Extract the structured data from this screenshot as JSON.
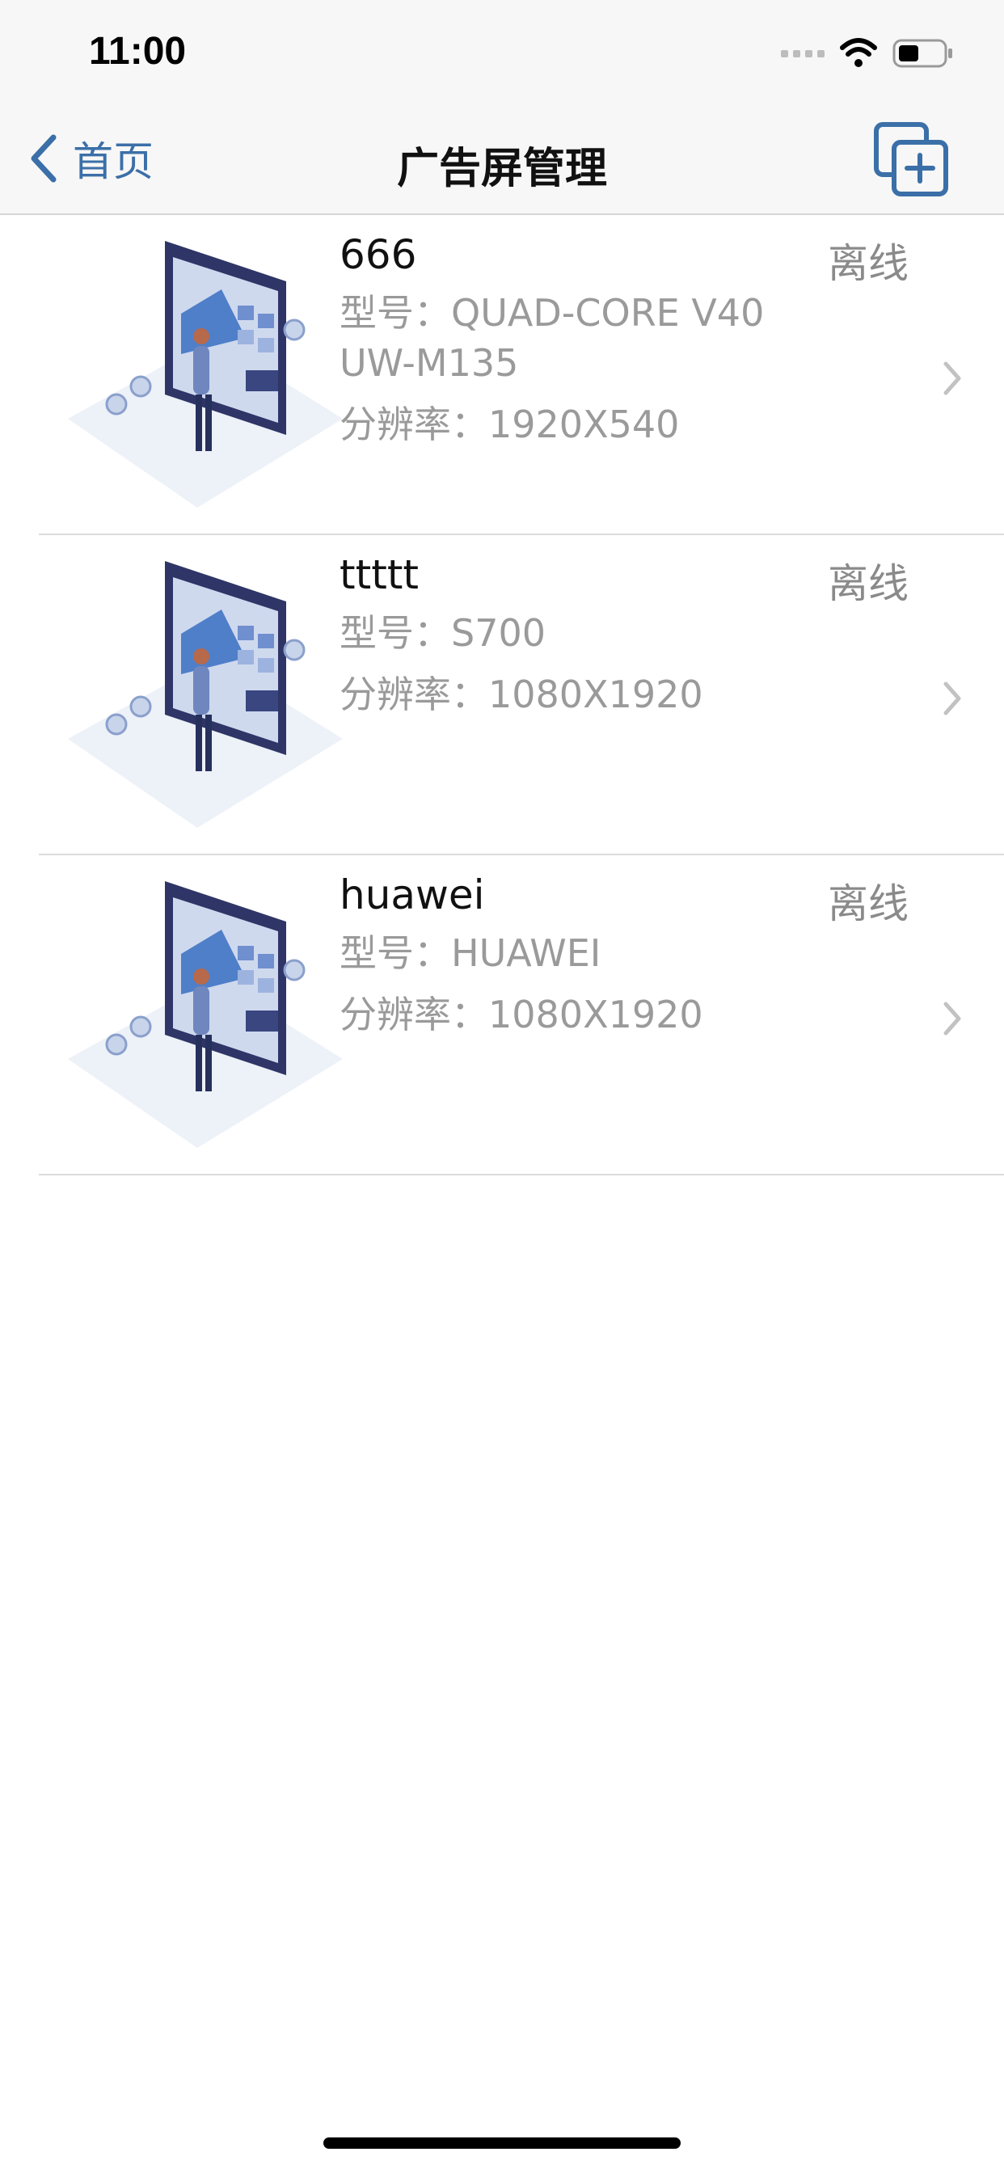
{
  "status_bar": {
    "time": "11:00"
  },
  "nav": {
    "back_label": "首页",
    "title": "广告屏管理"
  },
  "screens": [
    {
      "name": "666",
      "status": "离线",
      "model_label": "型号：",
      "model": "QUAD-CORE V40 UW-M135",
      "resolution_label": "分辨率：",
      "resolution": "1920X540"
    },
    {
      "name": "ttttt",
      "status": "离线",
      "model_label": "型号：",
      "model": "S700",
      "resolution_label": "分辨率：",
      "resolution": "1080X1920"
    },
    {
      "name": "huawei",
      "status": "离线",
      "model_label": "型号：",
      "model": "HUAWEI",
      "resolution_label": "分辨率：",
      "resolution": "1080X1920"
    }
  ],
  "colors": {
    "accent": "#3b6fa8",
    "secondary_text": "#9a9a9a"
  },
  "icons": [
    "back-chevron-icon",
    "add-copy-icon",
    "chevron-right-icon",
    "wifi-icon",
    "battery-icon"
  ]
}
